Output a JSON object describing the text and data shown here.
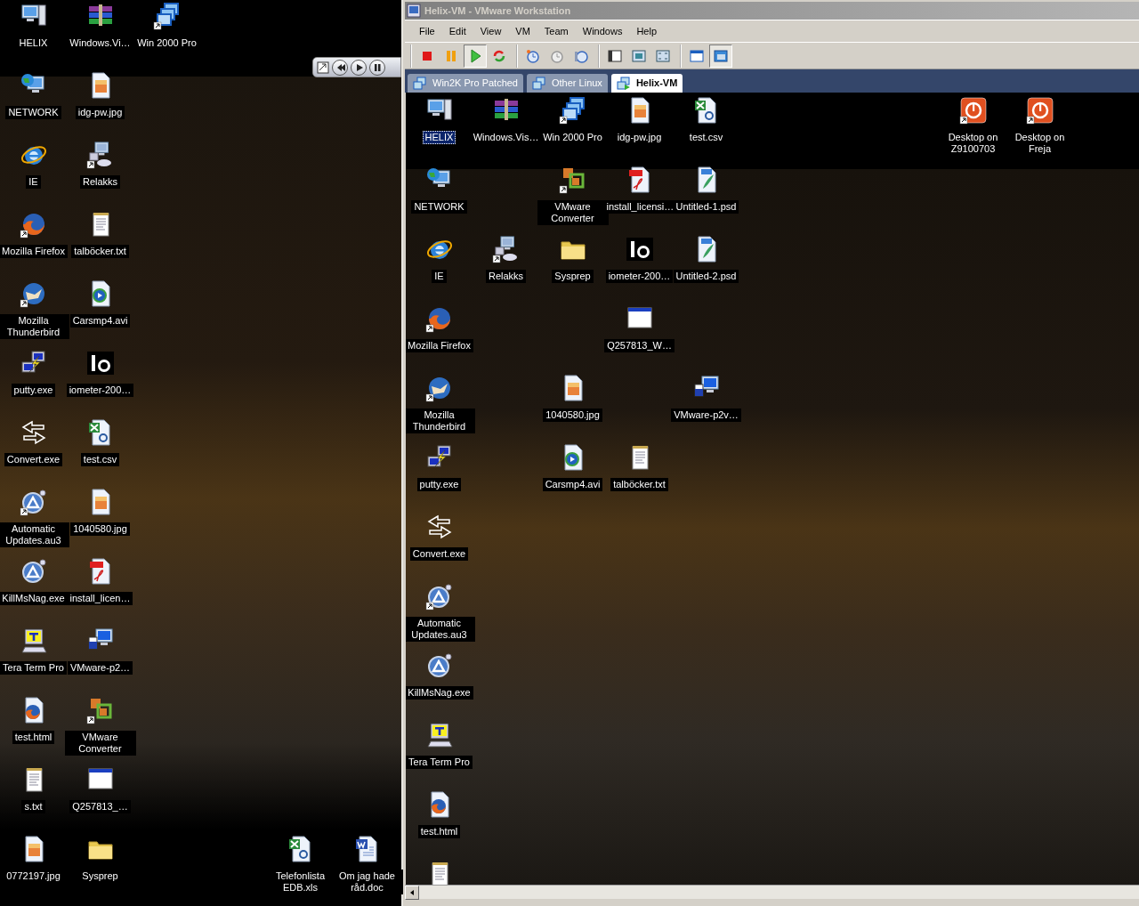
{
  "host_desktop": {
    "rows": [
      [
        {
          "label": "HELIX",
          "kind": "computer",
          "shortcut": false,
          "selected": false
        },
        {
          "label": "Windows.Vi…",
          "kind": "winrar",
          "shortcut": false,
          "selected": false
        },
        {
          "label": "Win 2000 Pro",
          "kind": "vm",
          "shortcut": true,
          "selected": false
        }
      ],
      [
        {
          "label": "NETWORK",
          "kind": "network",
          "shortcut": false,
          "selected": false
        },
        {
          "label": "idg-pw.jpg",
          "kind": "image",
          "shortcut": false,
          "selected": false
        }
      ],
      [
        {
          "label": "IE",
          "kind": "ie",
          "shortcut": false,
          "selected": false
        },
        {
          "label": "Relakks",
          "kind": "relakks",
          "shortcut": true,
          "selected": false
        }
      ],
      [
        {
          "label": "Mozilla Firefox",
          "kind": "firefox",
          "shortcut": true,
          "selected": false
        },
        {
          "label": "talböcker.txt",
          "kind": "text",
          "shortcut": false,
          "selected": false
        }
      ],
      [
        {
          "label": "Mozilla Thunderbird",
          "kind": "thunderbird",
          "shortcut": true,
          "selected": false
        },
        {
          "label": "Carsmp4.avi",
          "kind": "media",
          "shortcut": false,
          "selected": false
        }
      ],
      [
        {
          "label": "putty.exe",
          "kind": "putty",
          "shortcut": false,
          "selected": false
        },
        {
          "label": "iometer-200…",
          "kind": "iometer",
          "shortcut": false,
          "selected": false
        }
      ],
      [
        {
          "label": "Convert.exe",
          "kind": "convert",
          "shortcut": false,
          "selected": false
        },
        {
          "label": "test.csv",
          "kind": "excel",
          "shortcut": false,
          "selected": false
        }
      ],
      [
        {
          "label": "Automatic Updates.au3",
          "kind": "autoit",
          "shortcut": true,
          "selected": false
        },
        {
          "label": "1040580.jpg",
          "kind": "image",
          "shortcut": false,
          "selected": false
        }
      ],
      [
        {
          "label": "KillMsNag.exe",
          "kind": "autoit",
          "shortcut": false,
          "selected": false
        },
        {
          "label": "install_licen…",
          "kind": "pdf",
          "shortcut": false,
          "selected": false
        }
      ],
      [
        {
          "label": "Tera Term Pro",
          "kind": "teraterm",
          "shortcut": false,
          "selected": false
        },
        {
          "label": "VMware-p2…",
          "kind": "p2v",
          "shortcut": false,
          "selected": false
        }
      ],
      [
        {
          "label": "test.html",
          "kind": "html",
          "shortcut": false,
          "selected": false
        },
        {
          "label": "VMware Converter",
          "kind": "converter",
          "shortcut": true,
          "selected": false
        }
      ],
      [
        {
          "label": "s.txt",
          "kind": "text",
          "shortcut": false,
          "selected": false
        },
        {
          "label": "Q257813_…",
          "kind": "app",
          "shortcut": false,
          "selected": false
        }
      ],
      [
        {
          "label": "0772197.jpg",
          "kind": "image",
          "shortcut": false,
          "selected": false
        },
        {
          "label": "Sysprep",
          "kind": "folder",
          "shortcut": false,
          "selected": false
        },
        null,
        null,
        {
          "label": "Telefonlista EDB.xls",
          "kind": "excel",
          "shortcut": false,
          "selected": false
        },
        {
          "label": "Om jag hade råd.doc",
          "kind": "word",
          "shortcut": false,
          "selected": false
        }
      ]
    ]
  },
  "window": {
    "title": "Helix-VM - VMware Workstation",
    "menu": [
      "File",
      "Edit",
      "View",
      "VM",
      "Team",
      "Windows",
      "Help"
    ],
    "toolbar_groups": [
      {
        "buttons": [
          {
            "kind": "stop",
            "pressed": false
          },
          {
            "kind": "pause",
            "pressed": false
          },
          {
            "kind": "play",
            "pressed": true
          },
          {
            "kind": "reset",
            "pressed": false
          }
        ]
      },
      {
        "buttons": [
          {
            "kind": "snapshot",
            "pressed": false
          },
          {
            "kind": "revert",
            "pressed": false
          },
          {
            "kind": "manager",
            "pressed": false
          }
        ]
      },
      {
        "buttons": [
          {
            "kind": "normal-view",
            "pressed": false
          },
          {
            "kind": "full-screen",
            "pressed": false
          },
          {
            "kind": "quick-switch",
            "pressed": false
          }
        ]
      },
      {
        "buttons": [
          {
            "kind": "summary",
            "pressed": false
          },
          {
            "kind": "console",
            "pressed": true
          }
        ]
      }
    ],
    "tabs": [
      {
        "label": "Win2K Pro Patched",
        "selected": false
      },
      {
        "label": "Other Linux",
        "selected": false
      },
      {
        "label": "Helix-VM",
        "selected": true
      }
    ],
    "guest_desktop": {
      "rows": [
        [
          {
            "label": "HELIX",
            "kind": "computer",
            "shortcut": false,
            "selected": true
          },
          {
            "label": "Windows.Vis…",
            "kind": "winrar",
            "shortcut": false,
            "selected": false
          },
          {
            "label": "Win 2000 Pro",
            "kind": "vm",
            "shortcut": true,
            "selected": false
          },
          {
            "label": "idg-pw.jpg",
            "kind": "image",
            "shortcut": false,
            "selected": false
          },
          {
            "label": "test.csv",
            "kind": "excel",
            "shortcut": false,
            "selected": false
          },
          null,
          null,
          null,
          {
            "label": "Desktop on Z9100703",
            "kind": "rdp",
            "shortcut": true,
            "selected": false
          },
          {
            "label": "Desktop on Freja",
            "kind": "rdp",
            "shortcut": true,
            "selected": false
          }
        ],
        [
          {
            "label": "NETWORK",
            "kind": "network",
            "shortcut": false,
            "selected": false
          },
          null,
          {
            "label": "VMware Converter",
            "kind": "converter",
            "shortcut": true,
            "selected": false
          },
          {
            "label": "install_licensi…",
            "kind": "pdf",
            "shortcut": false,
            "selected": false
          },
          {
            "label": "Untitled-1.psd",
            "kind": "psd",
            "shortcut": false,
            "selected": false
          }
        ],
        [
          {
            "label": "IE",
            "kind": "ie",
            "shortcut": false,
            "selected": false
          },
          {
            "label": "Relakks",
            "kind": "relakks",
            "shortcut": true,
            "selected": false
          },
          {
            "label": "Sysprep",
            "kind": "folder",
            "shortcut": false,
            "selected": false
          },
          {
            "label": "iometer-200…",
            "kind": "iometer",
            "shortcut": false,
            "selected": false
          },
          {
            "label": "Untitled-2.psd",
            "kind": "psd",
            "shortcut": false,
            "selected": false
          }
        ],
        [
          {
            "label": "Mozilla Firefox",
            "kind": "firefox",
            "shortcut": true,
            "selected": false
          },
          null,
          null,
          {
            "label": "Q257813_W…",
            "kind": "app",
            "shortcut": false,
            "selected": false
          }
        ],
        [
          {
            "label": "Mozilla Thunderbird",
            "kind": "thunderbird",
            "shortcut": true,
            "selected": false
          },
          null,
          {
            "label": "1040580.jpg",
            "kind": "image",
            "shortcut": false,
            "selected": false
          },
          null,
          {
            "label": "VMware-p2v…",
            "kind": "p2v",
            "shortcut": false,
            "selected": false
          }
        ],
        [
          {
            "label": "putty.exe",
            "kind": "putty",
            "shortcut": false,
            "selected": false
          },
          null,
          {
            "label": "Carsmp4.avi",
            "kind": "media",
            "shortcut": false,
            "selected": false
          },
          {
            "label": "talböcker.txt",
            "kind": "text",
            "shortcut": false,
            "selected": false
          }
        ],
        [
          {
            "label": "Convert.exe",
            "kind": "convert",
            "shortcut": false,
            "selected": false
          }
        ],
        [
          {
            "label": "Automatic Updates.au3",
            "kind": "autoit",
            "shortcut": true,
            "selected": false
          }
        ],
        [
          {
            "label": "KillMsNag.exe",
            "kind": "autoit",
            "shortcut": false,
            "selected": false
          }
        ],
        [
          {
            "label": "Tera Term Pro",
            "kind": "teraterm",
            "shortcut": false,
            "selected": false
          }
        ],
        [
          {
            "label": "test.html",
            "kind": "html",
            "shortcut": false,
            "selected": false
          }
        ],
        [
          {
            "kind": "text",
            "shortcut": false,
            "selected": false
          }
        ]
      ]
    }
  }
}
